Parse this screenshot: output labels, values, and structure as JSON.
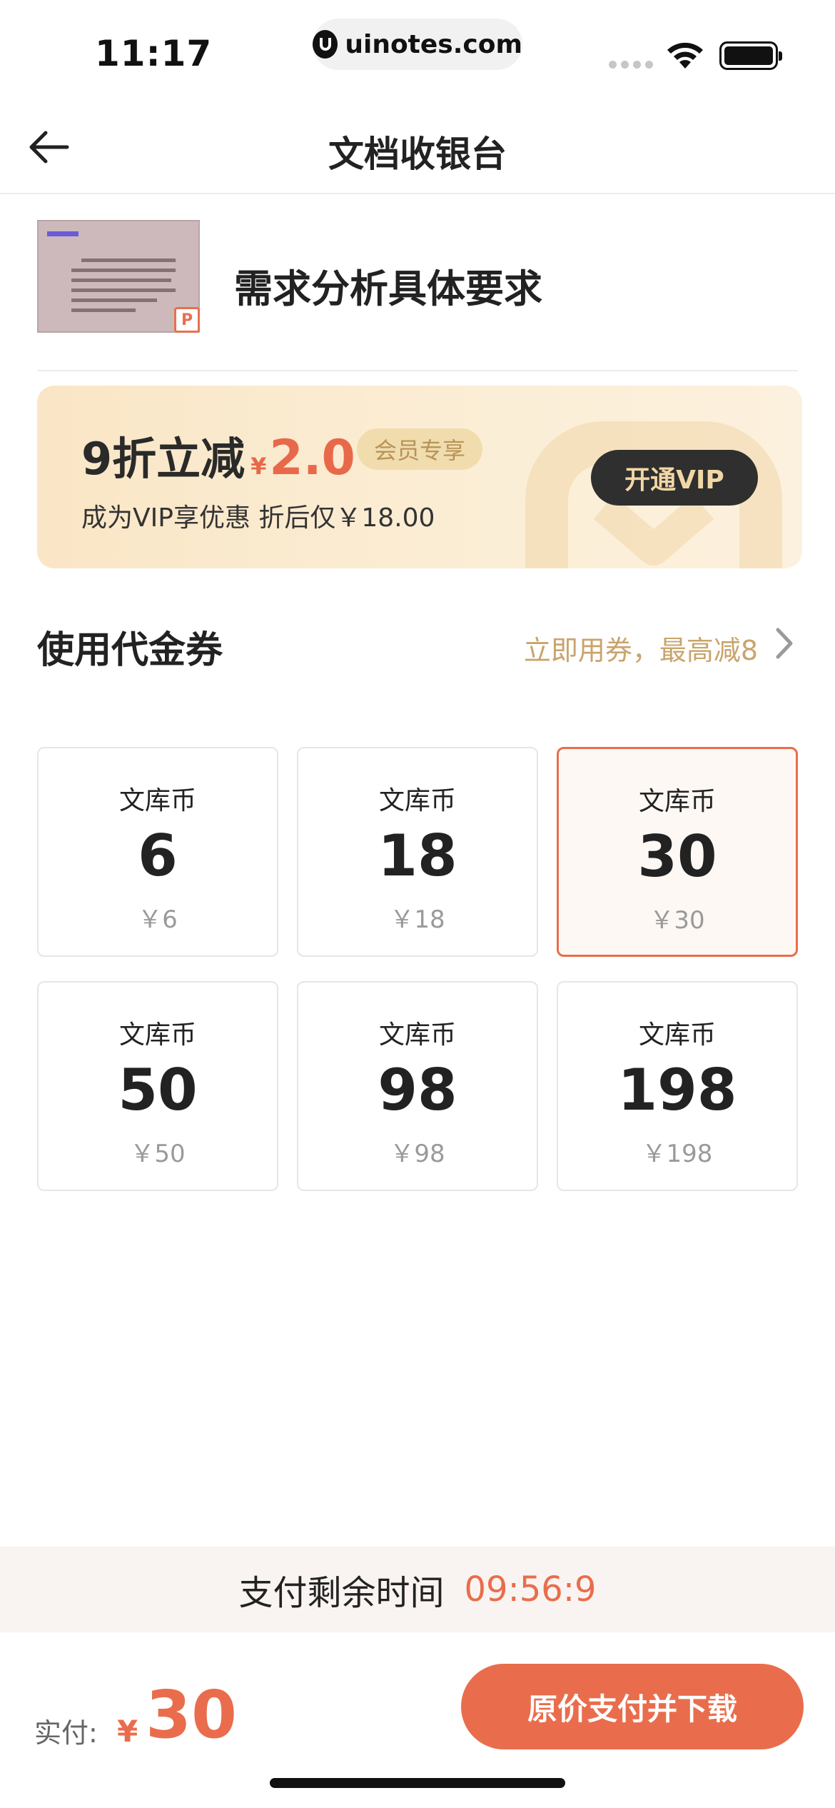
{
  "status_bar": {
    "time": "11:17",
    "url": "uinotes.com"
  },
  "nav": {
    "title": "文档收银台"
  },
  "document": {
    "title": "需求分析具体要求",
    "file_type_badge": "P"
  },
  "vip_banner": {
    "discount_label": "9折立减",
    "currency": "¥",
    "discount_amount": "2.0",
    "member_tag": "会员专享",
    "subtitle": "成为VIP享优惠 折后仅￥18.00",
    "button_label": "开通VIP"
  },
  "voucher": {
    "label": "使用代金券",
    "hint": "立即用券，最高减8"
  },
  "coins": [
    {
      "name": "文库币",
      "value": "6",
      "price": "￥6"
    },
    {
      "name": "文库币",
      "value": "18",
      "price": "￥18"
    },
    {
      "name": "文库币",
      "value": "30",
      "price": "￥30",
      "selected": true
    },
    {
      "name": "文库币",
      "value": "50",
      "price": "￥50"
    },
    {
      "name": "文库币",
      "value": "98",
      "price": "￥98"
    },
    {
      "name": "文库币",
      "value": "198",
      "price": "￥198"
    }
  ],
  "timer": {
    "label": "支付剩余时间",
    "value": "09:56:9"
  },
  "payment": {
    "label": "实付:",
    "currency": "¥",
    "amount": "30",
    "button_label": "原价支付并下载"
  },
  "colors": {
    "accent": "#e96d4c",
    "gold": "#c9a46c",
    "vip_dark": "#2f2f2f"
  }
}
